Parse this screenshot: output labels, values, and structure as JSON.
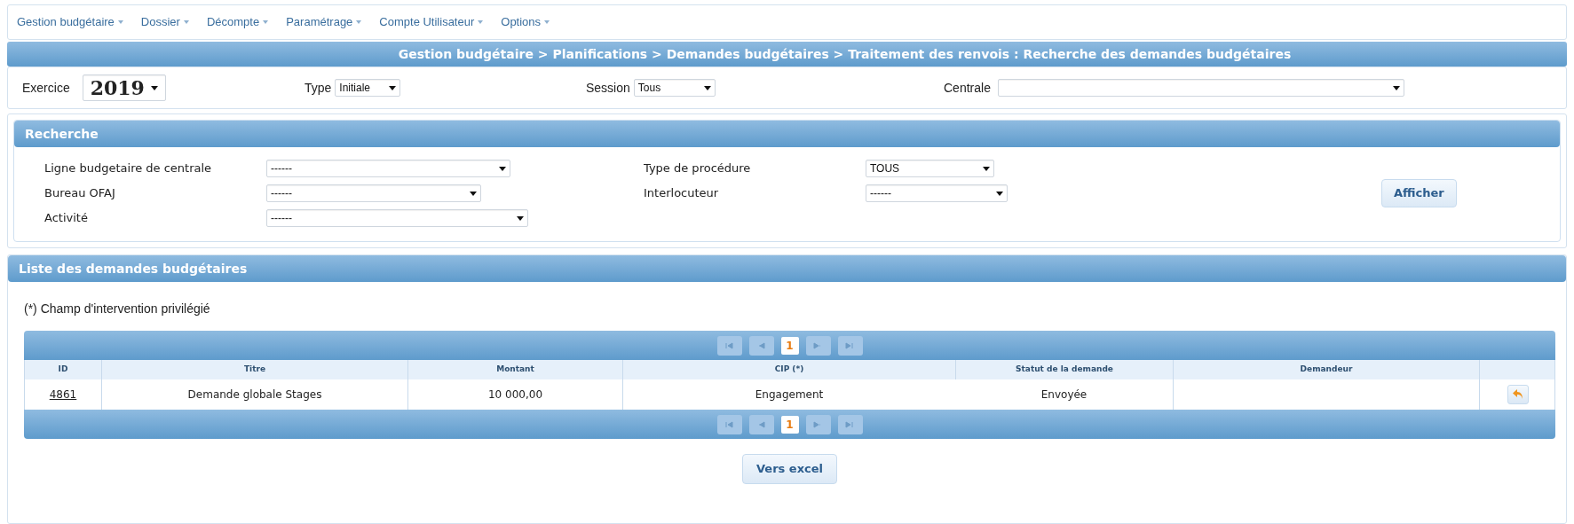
{
  "menu": [
    {
      "label": "Gestion budgétaire"
    },
    {
      "label": "Dossier"
    },
    {
      "label": "Décompte"
    },
    {
      "label": "Paramétrage"
    },
    {
      "label": "Compte Utilisateur"
    },
    {
      "label": "Options"
    }
  ],
  "breadcrumb": "Gestion budgétaire > Planifications > Demandes budgétaires > Traitement des renvois : Recherche des demandes budgétaires",
  "filters": [
    {
      "kind": "year",
      "label": "Exercice",
      "value": "2019"
    },
    {
      "kind": "select",
      "label": "Type",
      "value": "Initiale"
    },
    {
      "kind": "select",
      "label": "Session",
      "value": "Tous"
    },
    {
      "kind": "select",
      "label": "Centrale"
    }
  ],
  "search_panel": {
    "title": "Recherche",
    "fields": [
      {
        "label": "Ligne budgetaire de centrale",
        "value": "------"
      },
      {
        "label": "Type de procédure",
        "value": "TOUS"
      },
      {
        "label": "Bureau OFAJ",
        "value": "------"
      },
      {
        "label": "Interlocuteur",
        "value": "------"
      },
      {
        "label": "Activité",
        "value": "------"
      }
    ],
    "button": "Afficher"
  },
  "list_panel": {
    "title": "Liste des demandes budgétaires",
    "note": "(*) Champ d'intervention privilégié",
    "pager": {
      "buttons": [
        {
          "kind": "first",
          "disabled": true
        },
        {
          "kind": "prev",
          "disabled": true
        },
        {
          "kind": "page",
          "label": "1",
          "selected": true
        },
        {
          "kind": "next",
          "disabled": true
        },
        {
          "kind": "last",
          "disabled": true
        }
      ]
    },
    "pager_bottom": {
      "buttons": [
        {
          "kind": "first",
          "disabled": true
        },
        {
          "kind": "prev",
          "disabled": true
        },
        {
          "kind": "page",
          "label": "1",
          "selected": true
        },
        {
          "kind": "next",
          "disabled": true
        },
        {
          "kind": "last",
          "disabled": true
        }
      ]
    },
    "columns": [
      "ID",
      "Titre",
      "Montant",
      "CIP (*)",
      "Statut de la demande",
      "Demandeur"
    ],
    "rows": [
      {
        "id": "4861",
        "titre": "Demande globale Stages",
        "montant": "10 000,00",
        "cip": "Engagement",
        "statut": "Envoyée"
      }
    ],
    "export_button": "Vers excel"
  }
}
